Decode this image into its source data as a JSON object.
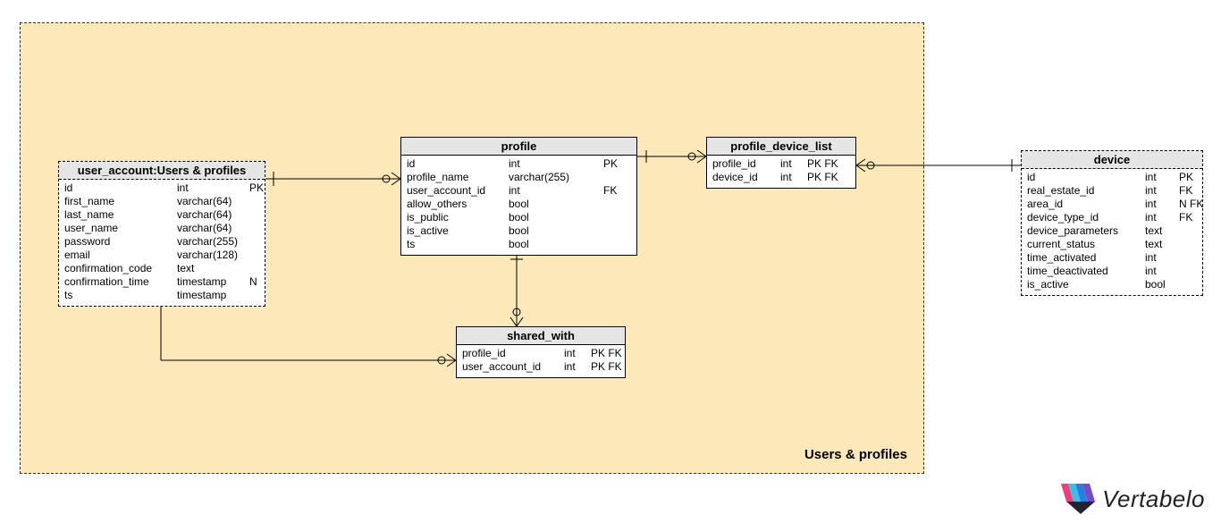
{
  "region": {
    "label": "Users & profiles"
  },
  "logo_text": "Vertabelo",
  "entities": {
    "user_account": {
      "title": "user_account:Users & profiles",
      "rows": [
        {
          "name": "id",
          "type": "int",
          "key": "PK"
        },
        {
          "name": "first_name",
          "type": "varchar(64)",
          "key": ""
        },
        {
          "name": "last_name",
          "type": "varchar(64)",
          "key": ""
        },
        {
          "name": "user_name",
          "type": "varchar(64)",
          "key": ""
        },
        {
          "name": "password",
          "type": "varchar(255)",
          "key": ""
        },
        {
          "name": "email",
          "type": "varchar(128)",
          "key": ""
        },
        {
          "name": "confirmation_code",
          "type": "text",
          "key": ""
        },
        {
          "name": "confirmation_time",
          "type": "timestamp",
          "key": "N"
        },
        {
          "name": "ts",
          "type": "timestamp",
          "key": ""
        }
      ]
    },
    "profile": {
      "title": "profile",
      "rows": [
        {
          "name": "id",
          "type": "int",
          "key": "PK"
        },
        {
          "name": "profile_name",
          "type": "varchar(255)",
          "key": ""
        },
        {
          "name": "user_account_id",
          "type": "int",
          "key": "FK"
        },
        {
          "name": "allow_others",
          "type": "bool",
          "key": ""
        },
        {
          "name": "is_public",
          "type": "bool",
          "key": ""
        },
        {
          "name": "is_active",
          "type": "bool",
          "key": ""
        },
        {
          "name": "ts",
          "type": "bool",
          "key": ""
        }
      ]
    },
    "profile_device_list": {
      "title": "profile_device_list",
      "rows": [
        {
          "name": "profile_id",
          "type": "int",
          "key": "PK FK"
        },
        {
          "name": "device_id",
          "type": "int",
          "key": "PK FK"
        }
      ]
    },
    "device": {
      "title": "device",
      "rows": [
        {
          "name": "id",
          "type": "int",
          "key": "PK"
        },
        {
          "name": "real_estate_id",
          "type": "int",
          "key": "FK"
        },
        {
          "name": "area_id",
          "type": "int",
          "key": "N FK"
        },
        {
          "name": "device_type_id",
          "type": "int",
          "key": "FK"
        },
        {
          "name": "device_parameters",
          "type": "text",
          "key": ""
        },
        {
          "name": "current_status",
          "type": "text",
          "key": ""
        },
        {
          "name": "time_activated",
          "type": "int",
          "key": ""
        },
        {
          "name": "time_deactivated",
          "type": "int",
          "key": ""
        },
        {
          "name": "is_active",
          "type": "bool",
          "key": ""
        }
      ]
    },
    "shared_with": {
      "title": "shared_with",
      "rows": [
        {
          "name": "profile_id",
          "type": "int",
          "key": "PK FK"
        },
        {
          "name": "user_account_id",
          "type": "int",
          "key": "PK FK"
        }
      ]
    }
  }
}
